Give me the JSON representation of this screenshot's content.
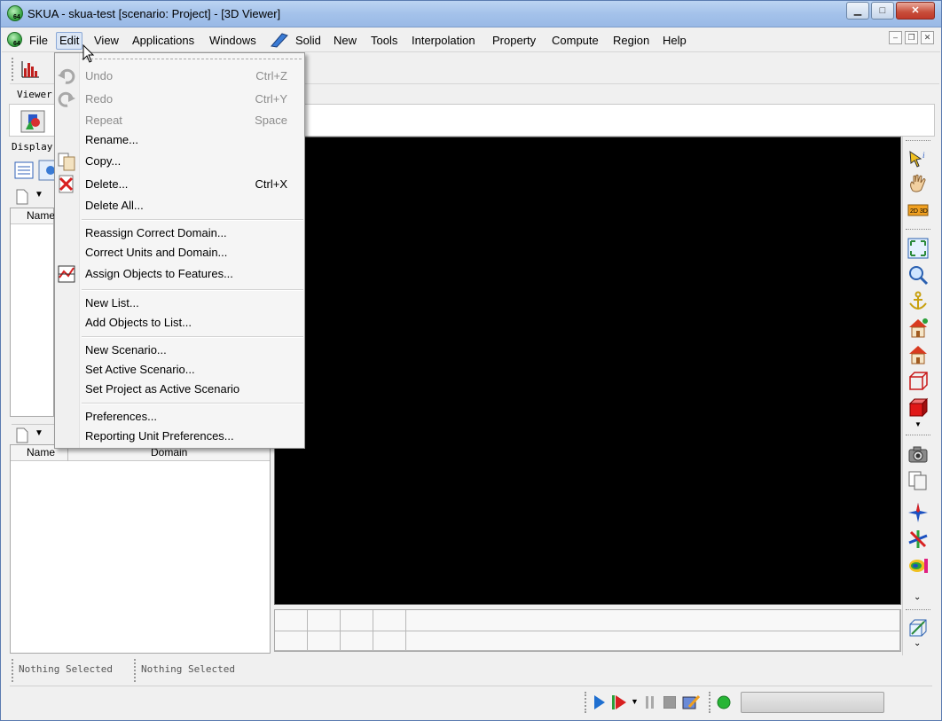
{
  "window": {
    "title": "SKUA - skua-test  [scenario: Project] - [3D Viewer]",
    "app_icon_badge": "64"
  },
  "menubar": {
    "items": [
      "File",
      "Edit",
      "View",
      "Applications",
      "Windows",
      "Solid",
      "New",
      "Tools",
      "Interpolation",
      "Property",
      "Compute",
      "Region",
      "Help"
    ]
  },
  "left_panel": {
    "viewer_tab": "Viewer",
    "display_label": "Display",
    "list1_header": "Name",
    "list2_header_name": "Name",
    "list2_header_domain": "Domain"
  },
  "edit_menu": {
    "items": [
      {
        "label": "Undo",
        "shortcut": "Ctrl+Z",
        "disabled": true,
        "icon": "undo-icon"
      },
      {
        "label": "Redo",
        "shortcut": "Ctrl+Y",
        "disabled": true,
        "icon": "redo-icon"
      },
      {
        "label": "Repeat",
        "shortcut": "Space",
        "disabled": true
      },
      {
        "label": "Rename...",
        "shortcut": "",
        "disabled": false
      },
      {
        "label": "Copy...",
        "shortcut": "",
        "disabled": false,
        "icon": "copy-icon"
      },
      {
        "label": "Delete...",
        "shortcut": "Ctrl+X",
        "disabled": false,
        "icon": "delete-icon"
      },
      {
        "label": "Delete All...",
        "shortcut": "",
        "disabled": false
      },
      {
        "label": "Reassign Correct Domain...",
        "shortcut": "",
        "disabled": false
      },
      {
        "label": "Correct Units and Domain...",
        "shortcut": "",
        "disabled": false
      },
      {
        "label": "Assign Objects to Features...",
        "shortcut": "",
        "disabled": false,
        "icon": "assign-features-icon"
      },
      {
        "label": "New List...",
        "shortcut": "",
        "disabled": false
      },
      {
        "label": "Add Objects to List...",
        "shortcut": "",
        "disabled": false
      },
      {
        "label": "New Scenario...",
        "shortcut": "",
        "disabled": false
      },
      {
        "label": "Set Active Scenario...",
        "shortcut": "",
        "disabled": false
      },
      {
        "label": "Set Project as Active Scenario",
        "shortcut": "",
        "disabled": false
      },
      {
        "label": "Preferences...",
        "shortcut": "",
        "disabled": false
      },
      {
        "label": "Reporting Unit Preferences...",
        "shortcut": "",
        "disabled": false
      }
    ]
  },
  "status": {
    "left": "Nothing Selected",
    "right": "Nothing Selected"
  },
  "colors": {
    "viewport": "#000000",
    "title_gradient": "#a4c2ea",
    "play": "#1f6fd0",
    "status_led": "#27b535"
  }
}
